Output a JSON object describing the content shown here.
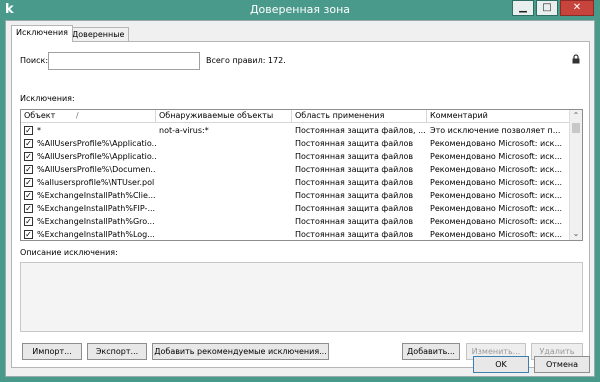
{
  "window": {
    "title": "Доверенная зона",
    "app_icon_glyph": "k",
    "minimize_glyph": "▁",
    "maximize_glyph": "□",
    "close_glyph": "✕"
  },
  "tabs": [
    {
      "label": "Исключения",
      "active": true
    },
    {
      "label": "Доверенные процессы",
      "active": false
    }
  ],
  "search": {
    "label": "Поиск:",
    "value": "",
    "placeholder": "",
    "total_rules_text": "Всего правил: 172."
  },
  "exclusions_label": "Исключения:",
  "table": {
    "columns": [
      "Объект",
      "Обнаруживаемые объекты",
      "Область применения",
      "Комментарий"
    ],
    "sort_indicator": "/",
    "rows": [
      {
        "checked": true,
        "object": "*",
        "detected": "not-a-virus:*",
        "scope": "Постоянная защита файлов, ...",
        "comment": "Это исключение позволяет п..."
      },
      {
        "checked": true,
        "object": "%AllUsersProfile%\\Applicatio...",
        "detected": "",
        "scope": "Постоянная защита файлов",
        "comment": "Рекомендовано Microsoft: иск..."
      },
      {
        "checked": true,
        "object": "%AllUsersProfile%\\Applicatio...",
        "detected": "",
        "scope": "Постоянная защита файлов",
        "comment": "Рекомендовано Microsoft: иск..."
      },
      {
        "checked": true,
        "object": "%AllUsersProfile%\\Documen...",
        "detected": "",
        "scope": "Постоянная защита файлов",
        "comment": "Рекомендовано Microsoft: иск..."
      },
      {
        "checked": true,
        "object": "%allusersprofile%\\NTUser.pol",
        "detected": "",
        "scope": "Постоянная защита файлов",
        "comment": "Рекомендовано Microsoft: иск..."
      },
      {
        "checked": true,
        "object": "%ExchangeInstallPath%Clie...",
        "detected": "",
        "scope": "Постоянная защита файлов",
        "comment": "Рекомендовано Microsoft: иск..."
      },
      {
        "checked": true,
        "object": "%ExchangeInstallPath%FIP-...",
        "detected": "",
        "scope": "Постоянная защита файлов",
        "comment": "Рекомендовано Microsoft: иск..."
      },
      {
        "checked": true,
        "object": "%ExchangeInstallPath%Gro...",
        "detected": "",
        "scope": "Постоянная защита файлов",
        "comment": "Рекомендовано Microsoft: иск..."
      },
      {
        "checked": true,
        "object": "%ExchangeInstallPath%Log...",
        "detected": "",
        "scope": "Постоянная защита файлов",
        "comment": "Рекомендовано Microsoft: иск..."
      }
    ]
  },
  "description_label": "Описание исключения:",
  "description_text": "",
  "buttons": {
    "import": "Импорт...",
    "export": "Экспорт...",
    "add_recommended": "Добавить рекомендуемые исключения...",
    "add": "Добавить...",
    "edit": "Изменить...",
    "delete": "Удалить",
    "ok": "OK",
    "cancel": "Отмена"
  },
  "colors": {
    "titlebar": "#4a9a8c",
    "close_button": "#c7443d",
    "dialog_bg": "#f0f0f0"
  }
}
